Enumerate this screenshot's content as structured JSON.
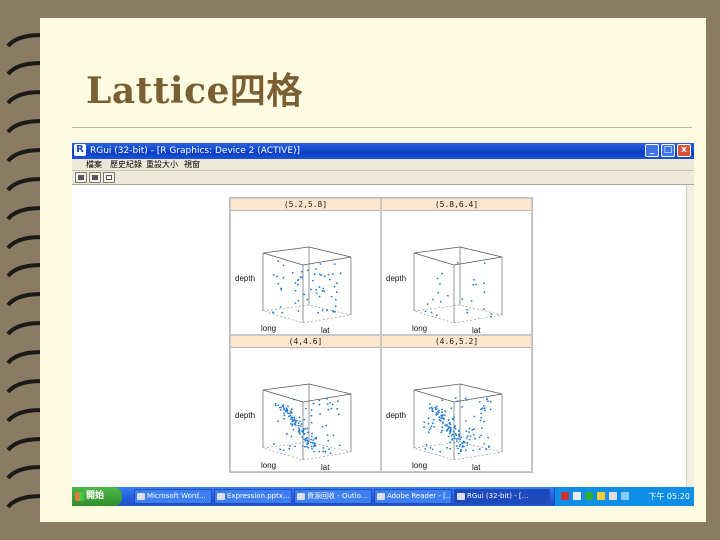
{
  "slide": {
    "title": "Lattice四格"
  },
  "window": {
    "title": "RGui (32-bit) - [R Graphics: Device 2 (ACTIVE)]",
    "app_icon": "R",
    "controls": [
      "_",
      "□",
      "x"
    ]
  },
  "menu": {
    "items": [
      "檔案",
      "歷史紀錄",
      "重設大小",
      "視窗"
    ]
  },
  "toolbar": {
    "icons": [
      "copy-icon",
      "print-icon",
      "window-icon"
    ]
  },
  "lattice": {
    "panels": [
      {
        "strip": "(5.2,5.8]",
        "axis_z": "depth",
        "axis_x": "long",
        "axis_y": "lat"
      },
      {
        "strip": "(5.8,6.4]",
        "axis_z": "depth",
        "axis_x": "long",
        "axis_y": "lat"
      },
      {
        "strip": "(4,4.6]",
        "axis_z": "depth",
        "axis_x": "long",
        "axis_y": "lat"
      },
      {
        "strip": "(4.6,5.2]",
        "axis_z": "depth",
        "axis_x": "long",
        "axis_y": "lat"
      }
    ],
    "point_color": "#1f7ad6"
  },
  "taskbar": {
    "start": "開始",
    "tasks": [
      "Microsoft Word...",
      "Expression.pptx...",
      "資源回收 - Outlo...",
      "Adobe Reader - [...",
      "RGui (32-bit) - [..."
    ],
    "clock": "下午 05:20"
  }
}
